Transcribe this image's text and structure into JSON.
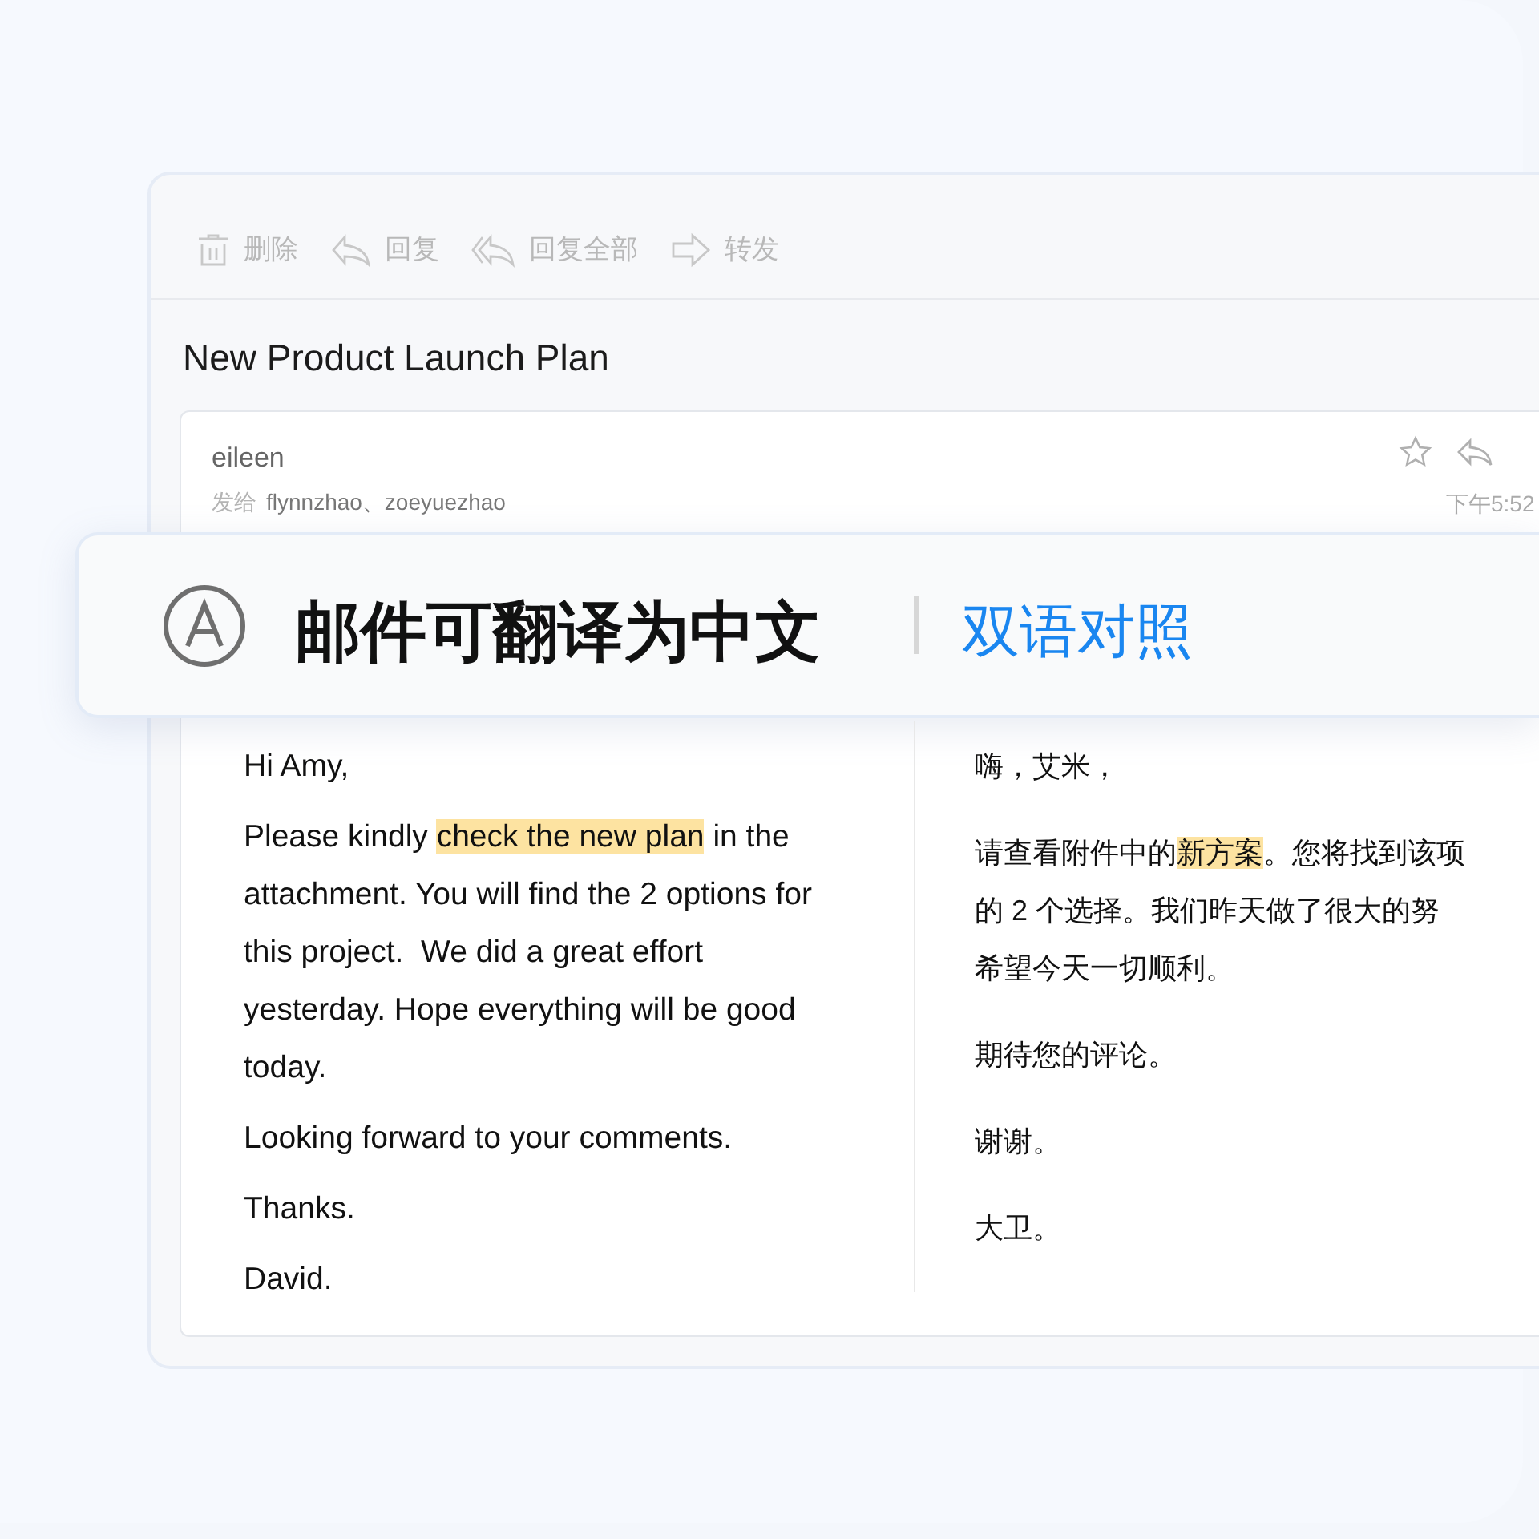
{
  "toolbar": [
    {
      "kind": "delete",
      "label": "删除"
    },
    {
      "kind": "reply",
      "label": "回复"
    },
    {
      "kind": "reply_all",
      "label": "回复全部"
    },
    {
      "kind": "forward",
      "label": "转发"
    }
  ],
  "subject": "New Product Launch Plan",
  "message": {
    "sender": "eileen",
    "to_label": "发给",
    "recipients": "flynnzhao、zoeyuezhao",
    "time": "下午5:52"
  },
  "banner": {
    "message": "邮件可翻译为中文",
    "action": "双语对照"
  },
  "original": [
    [
      {
        "text": "Hi Amy,",
        "highlighted": false
      }
    ],
    [
      {
        "text": "Please kindly ",
        "highlighted": false
      },
      {
        "text": "check the new plan",
        "highlighted": true
      },
      {
        "text": " in the attachment. You will find the 2 options for this project.  We did a great effort yesterday. Hope everything will be good today.",
        "highlighted": false
      }
    ],
    [
      {
        "text": "Looking forward to your comments.",
        "highlighted": false
      }
    ],
    [
      {
        "text": "Thanks.",
        "highlighted": false
      }
    ],
    [
      {
        "text": "David.",
        "highlighted": false
      }
    ]
  ],
  "translation": [
    [
      {
        "text": "嗨，艾米，",
        "highlighted": false
      }
    ],
    [
      {
        "text": "请查看附件中的",
        "highlighted": false
      },
      {
        "text": "新方案",
        "highlighted": true
      },
      {
        "text": "。您将找到该项",
        "highlighted": false
      }
    ],
    [
      {
        "text": "的 2 个选择。我们昨天做了很大的努",
        "highlighted": false
      }
    ],
    [
      {
        "text": "希望今天一切顺利。",
        "highlighted": false
      }
    ],
    [
      {
        "text": "期待您的评论。",
        "highlighted": false
      }
    ],
    [
      {
        "text": "谢谢。",
        "highlighted": false
      }
    ],
    [
      {
        "text": "大卫。",
        "highlighted": false
      }
    ]
  ]
}
